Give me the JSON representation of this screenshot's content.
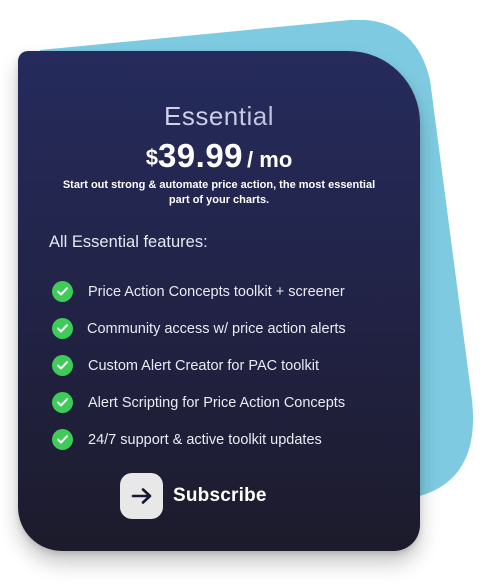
{
  "plan": {
    "name": "Essential",
    "currency": "$",
    "amount": "39.99",
    "period": "/ mo",
    "tagline": "Start out strong & automate price action, the most essential part of your charts."
  },
  "features": {
    "heading": "All Essential features:",
    "items": [
      {
        "label": "Price Action Concepts toolkit + screener",
        "icon": "check-circle-icon"
      },
      {
        "label": "Community access w/ price action alerts",
        "icon": "check-circle-icon"
      },
      {
        "label": "Custom Alert Creator for PAC toolkit",
        "icon": "check-circle-icon"
      },
      {
        "label": "Alert Scripting for Price Action Concepts",
        "icon": "check-circle-icon"
      },
      {
        "label": "24/7 support & active toolkit updates",
        "icon": "check-circle-icon"
      }
    ]
  },
  "cta": {
    "label": "Subscribe",
    "icon": "arrow-right-icon"
  },
  "colors": {
    "backdrop": "#7ecbe1",
    "card_top": "#252b5c",
    "card_bottom": "#1c1b2b",
    "check": "#3ecb58",
    "button_bg": "#e8e8e8"
  }
}
